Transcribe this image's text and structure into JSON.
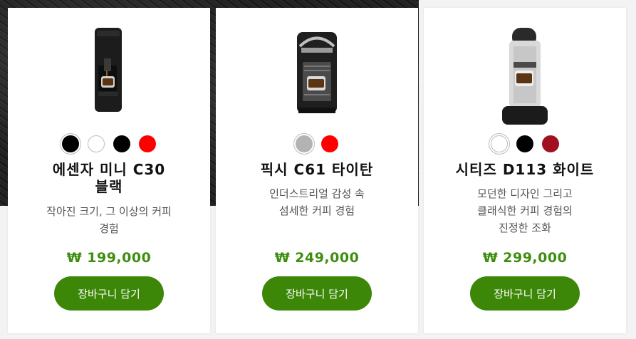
{
  "products": [
    {
      "name": "에센자 미니 C30\n블랙",
      "description": "작아진 크기, 그 이상의 커피\n경험",
      "price": "₩ 199,000",
      "cart_label": "장바구니 담기",
      "image": "espresso-machine-black",
      "swatches": [
        {
          "color": "#000000",
          "name": "black"
        },
        {
          "color": "#ffffff",
          "name": "white"
        },
        {
          "color": "#000000",
          "name": "black"
        },
        {
          "color": "#ff0000",
          "name": "red"
        }
      ]
    },
    {
      "name": "픽시 C61 타이탄",
      "description": "인더스트리얼 감성 속\n섬세한 커피 경험",
      "price": "₩ 249,000",
      "cart_label": "장바구니 담기",
      "image": "espresso-machine-titan",
      "swatches": [
        {
          "color": "#b3b3b3",
          "name": "gray"
        },
        {
          "color": "#ff0000",
          "name": "red"
        }
      ]
    },
    {
      "name": "시티즈 D113 화이트",
      "description": "모던한 디자인 그리고\n클래식한 커피 경험의\n진정한 조화",
      "price": "₩ 299,000",
      "cart_label": "장바구니 담기",
      "image": "espresso-machine-white",
      "swatches": [
        {
          "color": "#ffffff",
          "name": "white"
        },
        {
          "color": "#000000",
          "name": "black"
        },
        {
          "color": "#a01020",
          "name": "burgundy"
        }
      ]
    }
  ],
  "colors": {
    "price": "#3e8e0f",
    "button": "#3c8708"
  }
}
